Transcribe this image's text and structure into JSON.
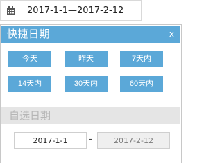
{
  "date_range_field": {
    "icon": "calendar-icon",
    "value": "2017-1-1—2017-2-12"
  },
  "quick_panel": {
    "title": "快捷日期",
    "close_label": "x",
    "buttons": [
      {
        "label": "今天"
      },
      {
        "label": "昨天"
      },
      {
        "label": "7天内"
      },
      {
        "label": "14天内"
      },
      {
        "label": "30天内"
      },
      {
        "label": "60天内"
      }
    ]
  },
  "custom_panel": {
    "title": "自选日期",
    "start_date": "2017-1-1",
    "separator": "-",
    "end_date": "2017-2-12"
  },
  "colors": {
    "accent": "#5ba8d8",
    "custom_header_bg": "#e5e5e5",
    "disabled_input_bg": "#efefef"
  }
}
